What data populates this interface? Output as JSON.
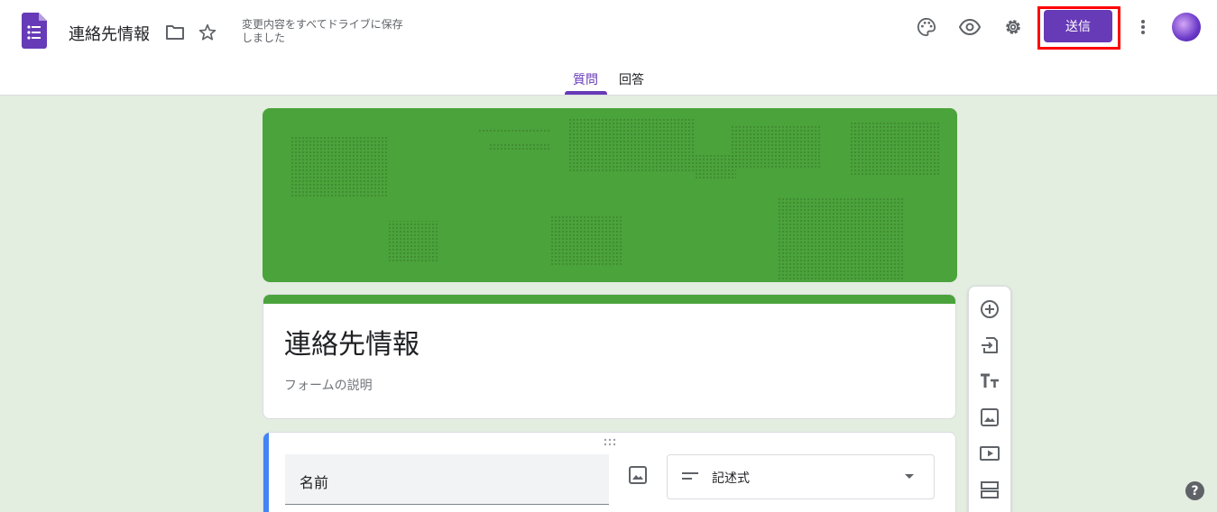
{
  "header": {
    "title": "連絡先情報",
    "save_status": "変更内容をすべてドライブに保存しました",
    "send_label": "送信"
  },
  "tabs": [
    {
      "label": "質問",
      "active": true
    },
    {
      "label": "回答",
      "active": false
    }
  ],
  "form": {
    "title": "連絡先情報",
    "description_placeholder": "フォームの説明"
  },
  "question": {
    "title": "名前",
    "type": "記述式"
  },
  "help_label": "?",
  "colors": {
    "accent": "#673ab7",
    "theme_green": "#4ba33b",
    "background": "#e3ede0",
    "focus_blue": "#4285f4",
    "highlight_red": "#ff0000"
  },
  "icons": {
    "header": [
      "forms-logo-icon",
      "folder-icon",
      "star-icon",
      "palette-icon",
      "preview-eye-icon",
      "settings-gear-icon",
      "more-vert-icon"
    ],
    "toolbar": [
      "add-question-icon",
      "import-questions-icon",
      "add-title-icon",
      "add-image-icon",
      "add-video-icon",
      "add-section-icon"
    ]
  }
}
